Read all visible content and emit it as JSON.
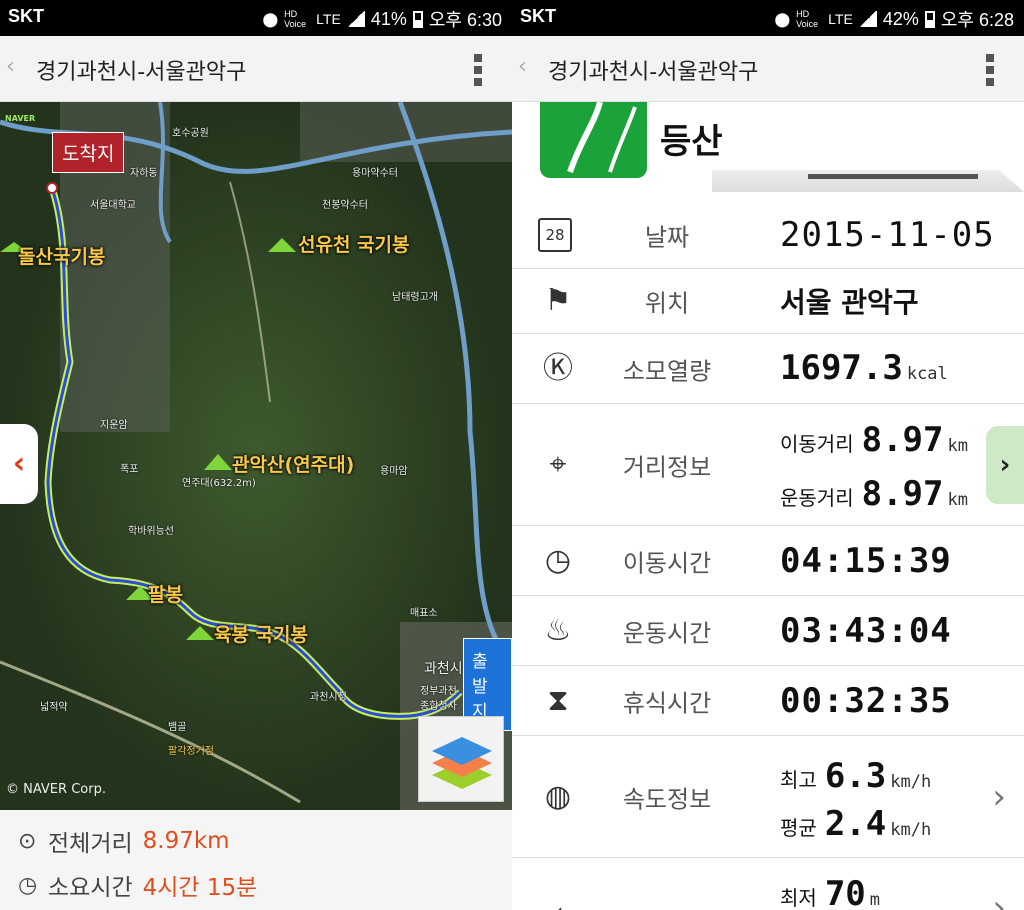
{
  "left": {
    "status": {
      "carrier": "SKT",
      "network": "LTE",
      "battery": "41%",
      "time": "오후 6:30",
      "hd": "HD Voice"
    },
    "appbar": {
      "title": "경기과천시-서울관악구"
    },
    "map": {
      "arrive_label": "도착지",
      "depart_label": "출발지",
      "peaks": [
        "돌산국기봉",
        "선유천 국기봉",
        "관악산(연주대)",
        "팔봉",
        "육봉 국기봉"
      ],
      "places": [
        "과천시",
        "지운암",
        "폭포",
        "연주대(632.2m)",
        "용마암",
        "남태령고개",
        "천봉약수터",
        "서울대학교",
        "매표소",
        "정부과천종합청사",
        "넓적약",
        "뱀골",
        "팔각정거점",
        "학바위능선",
        "자하동",
        "호수공원",
        "용마약수터",
        "과천시청"
      ],
      "copyright": "© NAVER Corp.",
      "naver": "NAVER",
      "layers_icon": "layers-icon"
    },
    "summary": {
      "distance_label": "전체거리",
      "distance_value": "8.97km",
      "time_label": "소요시간",
      "time_value": "4시간 15분"
    }
  },
  "right": {
    "status": {
      "carrier": "SKT",
      "network": "LTE",
      "battery": "42%",
      "time": "오후 6:28",
      "hd": "HD Voice"
    },
    "appbar": {
      "title": "경기과천시-서울관악구"
    },
    "activity": "등산",
    "rows": {
      "date": {
        "label": "날짜",
        "value": "2015-11-05",
        "icon_text": "28"
      },
      "location": {
        "label": "위치",
        "value": "서울 관악구"
      },
      "calories": {
        "label": "소모열량",
        "value": "1697.3",
        "unit": "kcal"
      },
      "distance": {
        "label": "거리정보",
        "move_label": "이동거리",
        "move_value": "8.97",
        "exercise_label": "운동거리",
        "exercise_value": "8.97",
        "unit": "km"
      },
      "move_time": {
        "label": "이동시간",
        "value": "04:15:39"
      },
      "exercise_time": {
        "label": "운동시간",
        "value": "03:43:04"
      },
      "rest_time": {
        "label": "휴식시간",
        "value": "00:32:35"
      },
      "speed": {
        "label": "속도정보",
        "max_label": "최고",
        "max_value": "6.3",
        "avg_label": "평균",
        "avg_value": "2.4",
        "unit": "km/h"
      },
      "altitude": {
        "min_label": "최저",
        "min_value": "70",
        "unit": "m"
      }
    }
  }
}
